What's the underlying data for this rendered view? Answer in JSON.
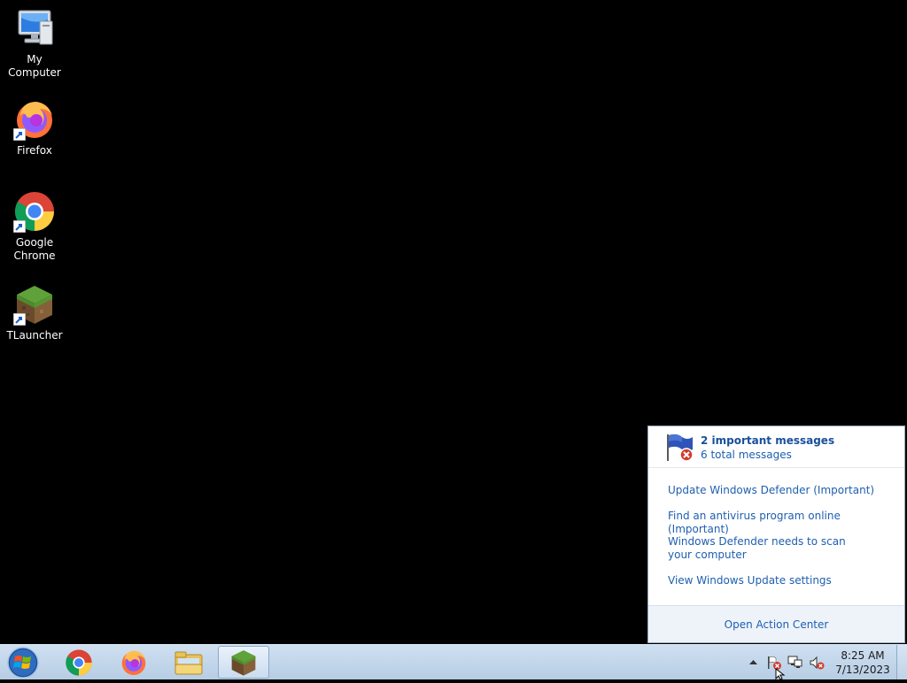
{
  "desktop": {
    "icons": [
      {
        "label": "My Computer",
        "icon": "computer-icon"
      },
      {
        "label": "Firefox",
        "icon": "firefox-icon"
      },
      {
        "label": "Google Chrome",
        "icon": "chrome-icon"
      },
      {
        "label": "TLauncher",
        "icon": "minecraft-grass-block-icon"
      }
    ]
  },
  "action_center": {
    "important": "2 important messages",
    "total": "6 total messages",
    "messages": [
      "Update Windows Defender (Important)",
      "Find an antivirus program online (Important)",
      "Windows Defender needs to scan your computer",
      "View Windows Update settings"
    ],
    "open_label": "Open Action Center"
  },
  "taskbar": {
    "pinned": [
      {
        "name": "Google Chrome",
        "icon": "chrome-icon"
      },
      {
        "name": "Firefox",
        "icon": "firefox-icon"
      },
      {
        "name": "Windows Explorer",
        "icon": "folder-icon"
      },
      {
        "name": "TLauncher",
        "icon": "minecraft-grass-block-icon",
        "active": true
      }
    ],
    "clock": {
      "time": "8:25 AM",
      "date": "7/13/2023"
    }
  },
  "colors": {
    "link": "#1e5fb0",
    "taskbar": "#c4d7eb",
    "desktop": "#000000"
  }
}
